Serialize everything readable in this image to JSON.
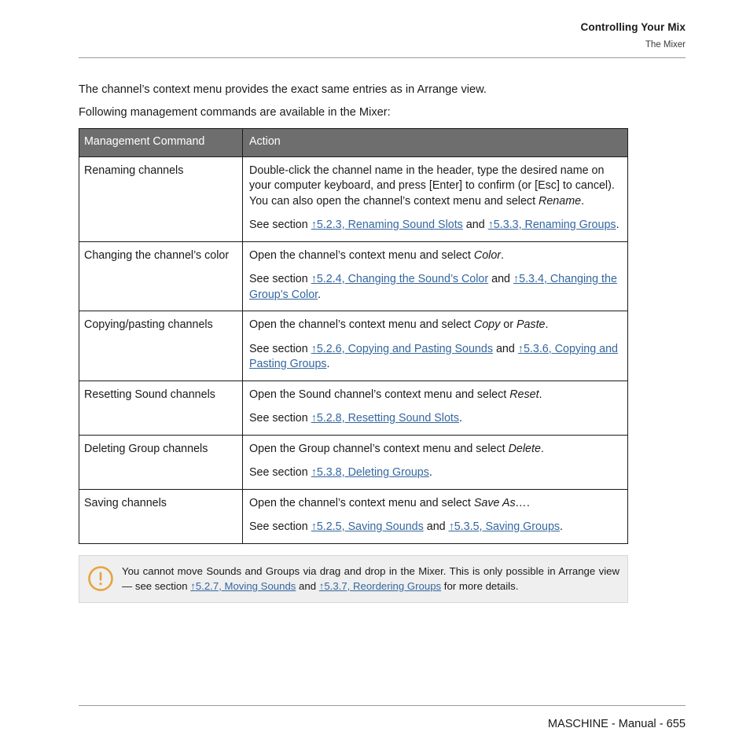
{
  "header": {
    "title": "Controlling Your Mix",
    "subtitle": "The Mixer"
  },
  "intro": {
    "paragraph_1": "The channel’s context menu provides the exact same entries as in Arrange view.",
    "paragraph_2": "Following management commands are available in the Mixer:"
  },
  "table": {
    "columns": [
      "Management Command",
      "Action"
    ],
    "rows": [
      {
        "command": "Renaming channels",
        "action_main_1": "Double-click the channel name in the header, type the desired name on your computer keyboard, and press [Enter] to confirm (or [Esc] to cancel). You can also open the channel’s context menu and select ",
        "action_main_italic": "Rename",
        "action_main_2": ".",
        "see_prefix": "See section ",
        "link_1": "↑5.2.3, Renaming Sound Slots",
        "see_mid": " and ",
        "link_2": "↑5.3.3, Renaming Groups",
        "see_suffix": "."
      },
      {
        "command": "Changing the channel’s color",
        "action_main_1": "Open the channel’s context menu and select ",
        "action_main_italic": "Color",
        "action_main_2": ".",
        "see_prefix": "See section ",
        "link_1": "↑5.2.4, Changing the Sound’s Color",
        "see_mid": " and ",
        "link_2": "↑5.3.4, Changing the Group’s Color",
        "see_suffix": "."
      },
      {
        "command": "Copying/pasting channels",
        "action_main_1": "Open the channel’s context menu and select ",
        "action_main_italic": "Copy",
        "action_main_mid": " or ",
        "action_main_italic_2": "Paste",
        "action_main_2": ".",
        "see_prefix": "See section ",
        "link_1": "↑5.2.6, Copying and Pasting Sounds",
        "see_mid": " and ",
        "link_2": "↑5.3.6, Copying and Pasting Groups",
        "see_suffix": "."
      },
      {
        "command": "Resetting Sound channels",
        "action_main_1": "Open the Sound channel’s context menu and select ",
        "action_main_italic": "Reset",
        "action_main_2": ".",
        "see_prefix": "See section ",
        "link_1": "↑5.2.8, Resetting Sound Slots",
        "see_suffix": "."
      },
      {
        "command": "Deleting Group channels",
        "action_main_1": "Open the Group channel’s context menu and select ",
        "action_main_italic": "Delete",
        "action_main_2": ".",
        "see_prefix": "See section ",
        "link_1": "↑5.3.8, Deleting Groups",
        "see_suffix": "."
      },
      {
        "command": "Saving channels",
        "action_main_1": "Open the channel’s context menu and select ",
        "action_main_italic": "Save As…",
        "action_main_2": ".",
        "see_prefix": "See section ",
        "link_1": "↑5.2.5, Saving Sounds",
        "see_mid": " and ",
        "link_2": "↑5.3.5, Saving Groups",
        "see_suffix": "."
      }
    ]
  },
  "note": {
    "icon": "exclamation-circle-icon",
    "text_1": "You cannot move Sounds and Groups via drag and drop in the Mixer. This is only possible in Arrange view — see section ",
    "link_1": "↑5.2.7, Moving Sounds",
    "text_mid": " and ",
    "link_2": "↑5.3.7, Reordering Groups",
    "text_2": " for more details."
  },
  "footer": {
    "text": "MASCHINE - Manual - 655"
  },
  "colors": {
    "link": "#34679f",
    "table_header_bg": "#6e6e6e",
    "note_bg": "#efefef",
    "note_icon": "#e8a33d",
    "rule": "#9a9a9a"
  }
}
